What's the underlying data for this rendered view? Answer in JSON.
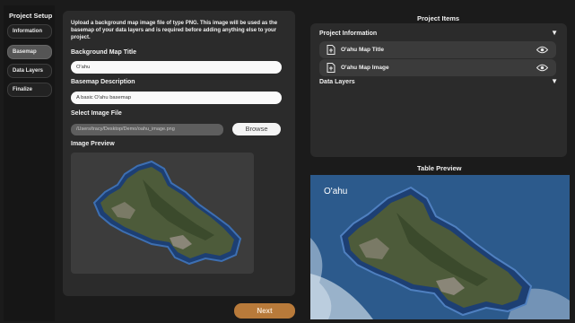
{
  "sidebar": {
    "title": "Project Setup",
    "steps": [
      {
        "label": "Information"
      },
      {
        "label": "Basemap"
      },
      {
        "label": "Data Layers"
      },
      {
        "label": "Finalize"
      }
    ]
  },
  "basemap": {
    "intro": "Upload a background map image file of type PNG. This image will be used as the basemap of your data layers and is required before adding anything else to your project.",
    "title_label": "Background Map Title",
    "title_value": "O'ahu",
    "description_label": "Basemap Description",
    "description_value": "A basic O'ahu basemap",
    "file_label": "Select Image File",
    "file_value": "/Users/tracy/Desktop/Demo/oahu_image.png",
    "browse_label": "Browse",
    "preview_label": "Image Preview",
    "next_label": "Next"
  },
  "project_items": {
    "title": "Project Items",
    "sections": [
      {
        "label": "Project Information",
        "items": [
          {
            "label": "O'ahu Map Title"
          },
          {
            "label": "O'ahu Map Image"
          }
        ]
      },
      {
        "label": "Data Layers",
        "items": []
      }
    ]
  },
  "table_preview": {
    "title": "Table Preview",
    "map_label": "O'ahu"
  },
  "icons": {
    "caret": "caret-down-icon",
    "item": "file-icon",
    "visibility": "eye-icon"
  },
  "colors": {
    "next_button": "#b87a3a",
    "ocean": "#2c5a8c",
    "panel": "#2b2b2b"
  }
}
